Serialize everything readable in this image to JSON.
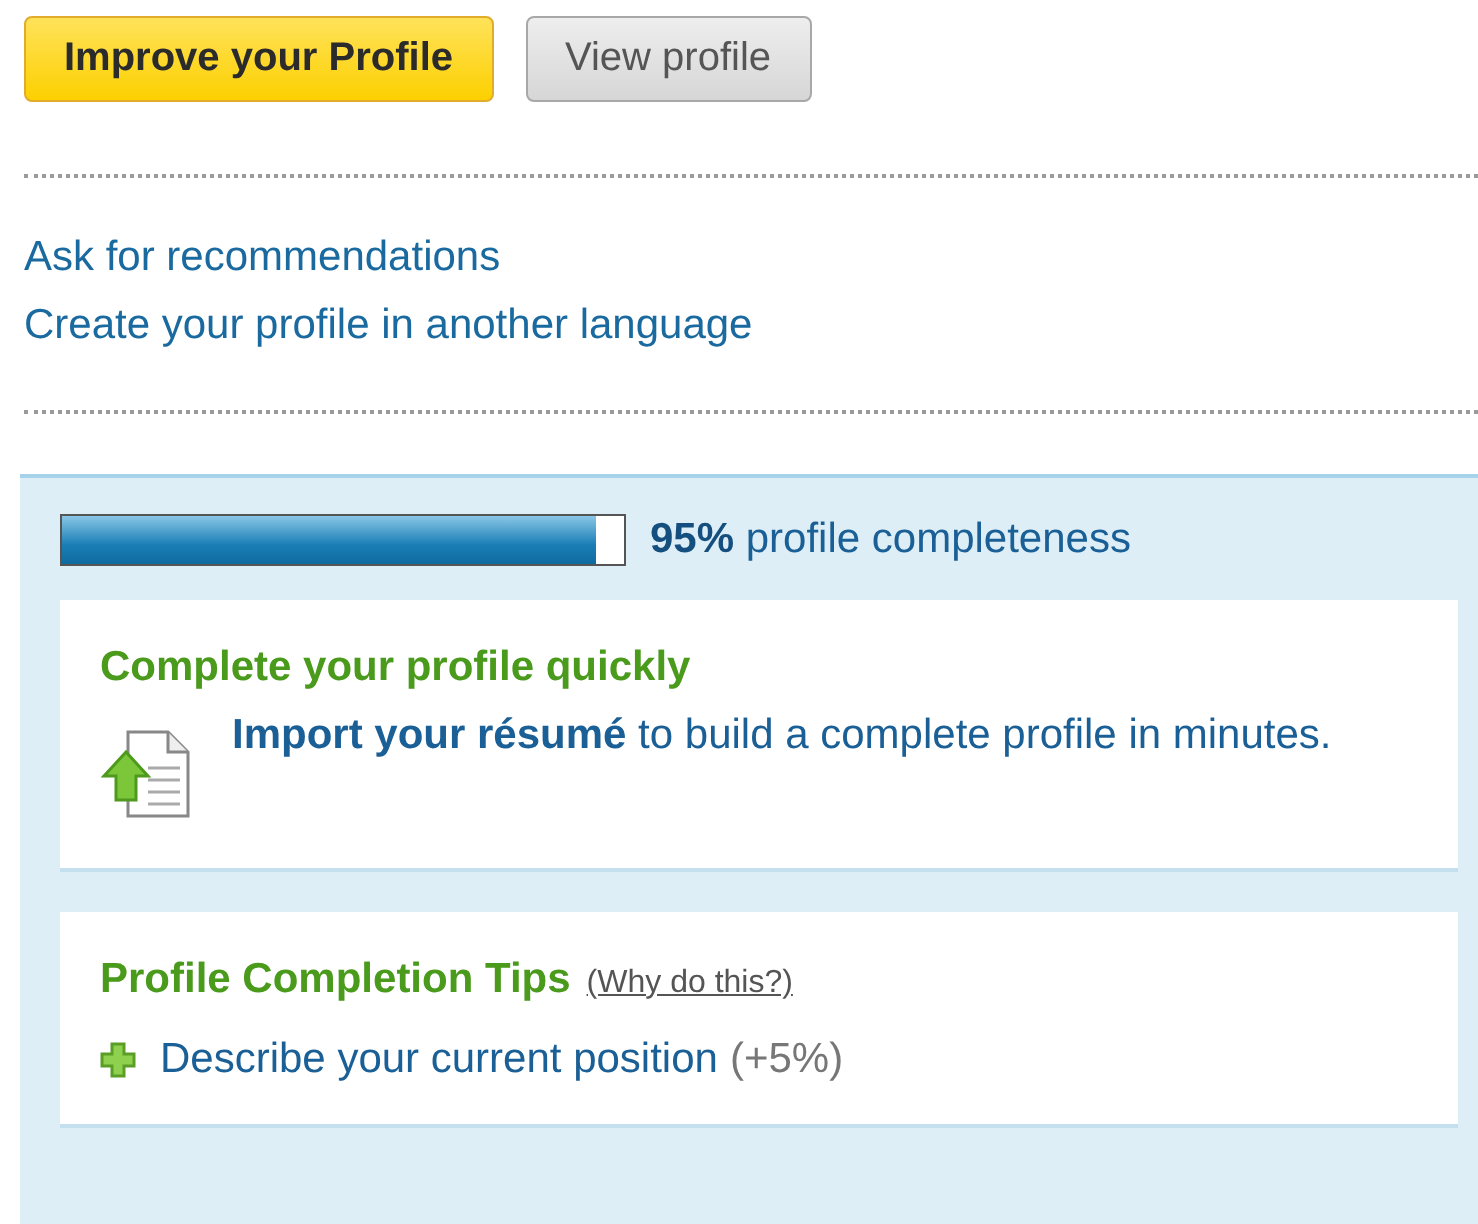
{
  "buttons": [
    {
      "label": "Improve your Profile",
      "kind": "primary"
    },
    {
      "label": "View profile",
      "kind": "secondary"
    }
  ],
  "links": [
    "Ask for recommendations",
    "Create your profile in another language"
  ],
  "progress": {
    "level": 0.95,
    "text": "**95%** profile completeness"
  },
  "import_card": {
    "title": "Complete your profile quickly",
    "link": "Import your résumé",
    "text": "to build a complete profile in minutes."
  },
  "tips_card": {
    "title": "Profile Completion Tips",
    "help_link": "(Why do this?)",
    "tips": [
      {
        "label": "Describe your current position",
        "gain": "(+5%)"
      }
    ]
  }
}
